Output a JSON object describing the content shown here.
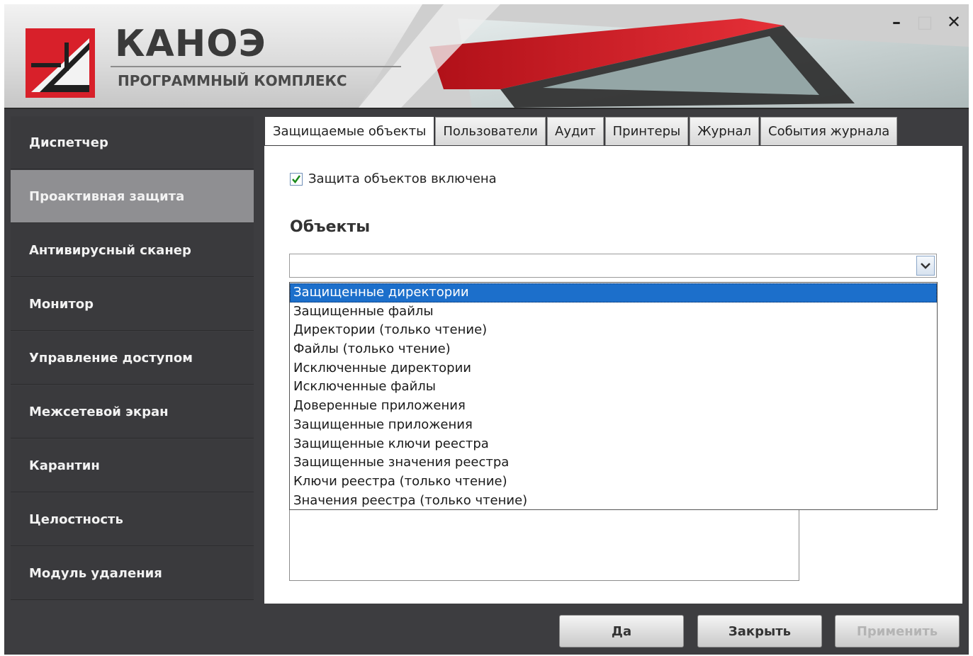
{
  "header": {
    "title": "КАНОЭ",
    "subtitle": "ПРОГРАММНЫЙ КОМПЛЕКС",
    "minimize_label": "–",
    "maximize_label": "□",
    "close_label": "✕"
  },
  "sidebar": {
    "items": [
      {
        "label": "Диспетчер"
      },
      {
        "label": "Проактивная защита"
      },
      {
        "label": "Антивирусный сканер"
      },
      {
        "label": "Монитор"
      },
      {
        "label": "Управление доступом"
      },
      {
        "label": "Межсетевой экран"
      },
      {
        "label": "Карантин"
      },
      {
        "label": "Целостность"
      },
      {
        "label": "Модуль удаления"
      }
    ],
    "active_index": 1
  },
  "tabs": [
    {
      "label": "Защищаемые объекты"
    },
    {
      "label": "Пользователи"
    },
    {
      "label": "Аудит"
    },
    {
      "label": "Принтеры"
    },
    {
      "label": "Журнал"
    },
    {
      "label": "События журнала"
    }
  ],
  "main": {
    "checkbox_label": "Защита объектов включена",
    "checkbox_checked": true,
    "section_title": "Объекты",
    "combo_value": "",
    "dropdown_options": [
      "Защищенные директории",
      "Защищенные файлы",
      "Директории (только чтение)",
      "Файлы (только чтение)",
      "Исключенные директории",
      "Исключенные файлы",
      "Доверенные приложения",
      "Защищенные приложения",
      "Защищенные ключи реестра",
      "Защищенные значения реестра",
      "Ключи реестра (только чтение)",
      "Значения реестра (только чтение)"
    ],
    "dropdown_selected_index": 0
  },
  "footer": {
    "yes_label": "Да",
    "close_label": "Закрыть",
    "apply_label": "Применить"
  },
  "colors": {
    "accent_red": "#d8202a",
    "selection_blue": "#1c6fcb",
    "sidebar_bg": "#3a3a3d",
    "sidebar_active": "#8f8f92"
  }
}
